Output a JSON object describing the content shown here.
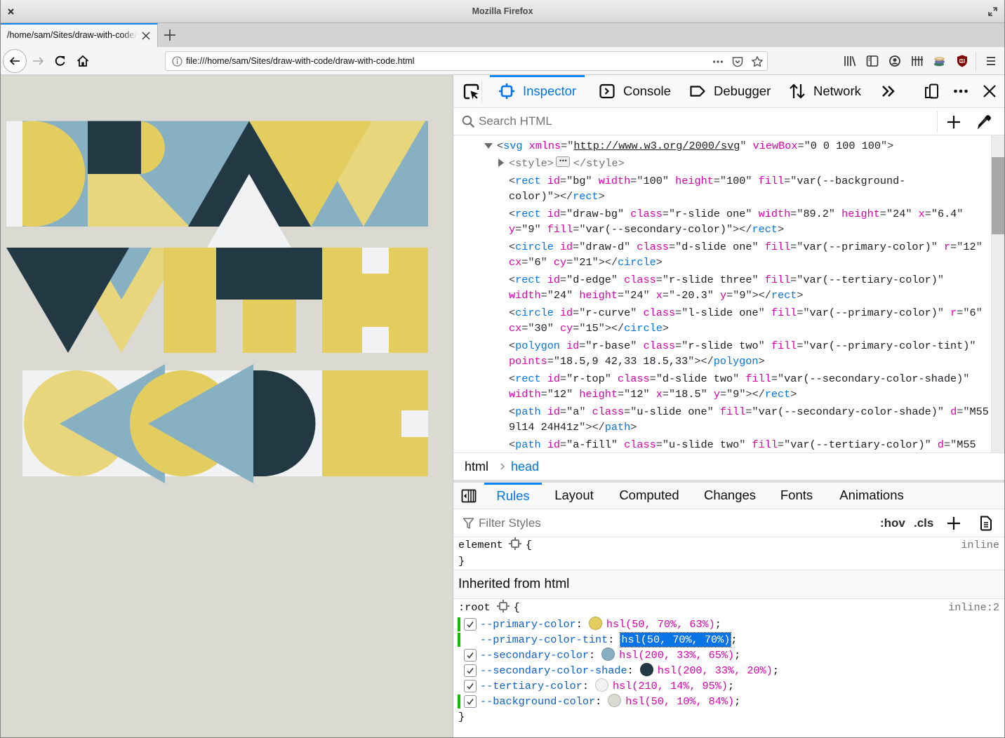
{
  "window": {
    "title": "Mozilla Firefox"
  },
  "browser": {
    "tabs": [
      {
        "label": "/home/sam/Sites/draw-with-code/",
        "active": true
      }
    ],
    "url": "file:///home/sam/Sites/draw-with-code/draw-with-code.html"
  },
  "palette": {
    "primary": "#e3cd5f",
    "primary_tint": "#e8d67d",
    "secondary": "#88b0c3",
    "secondary_shade": "#223944",
    "tertiary": "#f0f2f4",
    "background": "#dad9d2"
  },
  "devtools": {
    "tabs": [
      {
        "label": "Inspector",
        "icon": "inspector-icon",
        "active": true
      },
      {
        "label": "Console",
        "icon": "console-icon"
      },
      {
        "label": "Debugger",
        "icon": "debugger-icon"
      },
      {
        "label": "Network",
        "icon": "network-icon"
      }
    ],
    "search_placeholder": "Search HTML",
    "markup": {
      "nodes": [
        {
          "depth": 0,
          "twisty": "expanded",
          "lines": [
            "<svg xmlns=\"http://www.w3.org/2000/svg\" viewBox=\"0 0 100 100\">"
          ]
        },
        {
          "depth": 1,
          "twisty": "collapsed",
          "dim": true,
          "lines": [
            "<style>"
          ],
          "badge": "•••",
          "after_badge": "</style>"
        },
        {
          "depth": 1,
          "lines": [
            "<rect id=\"bg\" width=\"100\" height=\"100\" fill=\"var(--background-",
            "color)\"></rect>"
          ]
        },
        {
          "depth": 1,
          "lines": [
            "<rect id=\"draw-bg\" class=\"r-slide one\" width=\"89.2\" height=\"24\" x=\"6.4\"",
            "y=\"9\" fill=\"var(--secondary-color)\"></rect>"
          ]
        },
        {
          "depth": 1,
          "lines": [
            "<circle id=\"draw-d\" class=\"d-slide one\" fill=\"var(--primary-color)\" r=\"12\"",
            "cx=\"6\" cy=\"21\"></circle>"
          ]
        },
        {
          "depth": 1,
          "lines": [
            "<rect id=\"d-edge\" class=\"r-slide three\" fill=\"var(--tertiary-color)\"",
            "width=\"24\" height=\"24\" x=\"-20.3\" y=\"9\"></rect>"
          ]
        },
        {
          "depth": 1,
          "lines": [
            "<circle id=\"r-curve\" class=\"l-slide one\" fill=\"var(--primary-color)\" r=\"6\"",
            "cx=\"30\" cy=\"15\"></circle>"
          ]
        },
        {
          "depth": 1,
          "lines": [
            "<polygon id=\"r-base\" class=\"r-slide two\" fill=\"var(--primary-color-tint)\"",
            "points=\"18.5,9 42,33 18.5,33\"></polygon>"
          ]
        },
        {
          "depth": 1,
          "lines": [
            "<rect id=\"r-top\" class=\"d-slide two\" fill=\"var(--secondary-color-shade)\"",
            "width=\"12\" height=\"12\" x=\"18.5\" y=\"9\"></rect>"
          ]
        },
        {
          "depth": 1,
          "lines": [
            "<path id=\"a\" class=\"u-slide one\" fill=\"var(--secondary-color-shade)\" d=\"M55",
            "9l14 24H41z\"></path>"
          ]
        },
        {
          "depth": 1,
          "lines": [
            "<path id=\"a-fill\" class=\"u-slide two\" fill=\"var(--tertiary-color)\" d=\"M55"
          ]
        }
      ]
    },
    "breadcrumbs": [
      {
        "label": "html"
      },
      {
        "label": "head",
        "selected": true
      }
    ],
    "sidebar_tabs": [
      {
        "label": "Rules",
        "active": true
      },
      {
        "label": "Layout"
      },
      {
        "label": "Computed"
      },
      {
        "label": "Changes"
      },
      {
        "label": "Fonts"
      },
      {
        "label": "Animations"
      }
    ],
    "filter_placeholder": "Filter Styles",
    "hov_label": ":hov",
    "cls_label": ".cls",
    "rules": {
      "punct": {
        "open": "{",
        "close": "}",
        "colon": ":",
        "semicolon": ";"
      },
      "element": {
        "selector": "element",
        "source": "inline"
      },
      "inherited_header": "Inherited from html",
      "root": {
        "selector": ":root",
        "source": "inline:2",
        "declarations": [
          {
            "name": "--primary-color",
            "value": "hsl(50, 70%, 63%)",
            "swatch": "#e3cd5f",
            "checkbox": true,
            "checked": true,
            "changed": true
          },
          {
            "name": "--primary-color-tint",
            "value": "hsl(50, 70%, 70%)",
            "swatch": null,
            "checkbox": false,
            "changed": true,
            "editing": true
          },
          {
            "name": "--secondary-color",
            "value": "hsl(200, 33%, 65%)",
            "swatch": "#88b0c3",
            "checkbox": true,
            "checked": true,
            "changed": false
          },
          {
            "name": "--secondary-color-shade",
            "value": "hsl(200, 33%, 20%)",
            "swatch": "#223944",
            "checkbox": true,
            "checked": true,
            "changed": false
          },
          {
            "name": "--tertiary-color",
            "value": "hsl(210, 14%, 95%)",
            "swatch": "#f0f2f4",
            "checkbox": true,
            "checked": true,
            "changed": false
          },
          {
            "name": "--background-color",
            "value": "hsl(50, 10%, 84%)",
            "swatch": "#dad9d2",
            "checkbox": true,
            "checked": true,
            "changed": true
          }
        ]
      }
    }
  }
}
